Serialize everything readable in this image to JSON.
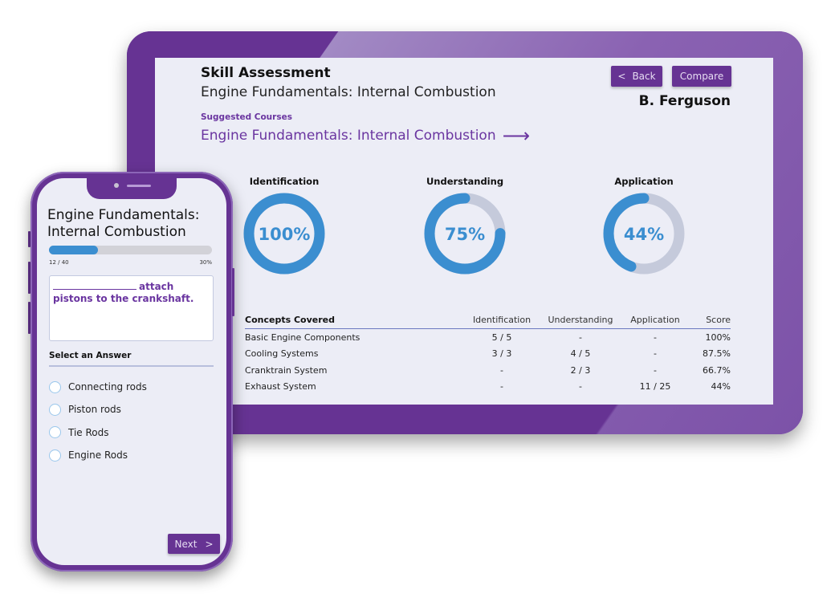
{
  "tablet": {
    "title": "Skill Assessment",
    "subtitle": "Engine Fundamentals: Internal Combustion",
    "suggested_label": "Suggested Courses",
    "suggested_course": "Engine Fundamentals: Internal Combustion",
    "suggested_arrow": "⟶",
    "back_button": {
      "icon": "<",
      "label": "Back"
    },
    "compare_button": "Compare",
    "user_name": "B. Ferguson",
    "gauges": [
      {
        "label": "Identification",
        "value_text": "100%",
        "percent": 100
      },
      {
        "label": "Understanding",
        "value_text": "75%",
        "percent": 75
      },
      {
        "label": "Application",
        "value_text": "44%",
        "percent": 44
      }
    ],
    "gauge_colors": {
      "fill": "#3b8ed0",
      "track": "#c5cadb"
    },
    "table": {
      "headers": [
        "Concepts Covered",
        "Identification",
        "Understanding",
        "Application",
        "Score"
      ],
      "rows": [
        [
          "Basic Engine Components",
          "5 / 5",
          "-",
          "-",
          "100%"
        ],
        [
          "Cooling Systems",
          "3 / 3",
          "4 / 5",
          "-",
          "87.5%"
        ],
        [
          "Cranktrain System",
          "-",
          "2 / 3",
          "-",
          "66.7%"
        ],
        [
          "Exhaust System",
          "-",
          "-",
          "11 / 25",
          "44%"
        ]
      ]
    }
  },
  "phone": {
    "title": "Engine Fundamentals: Internal Combustion",
    "progress": {
      "count_text": "12 / 40",
      "percent_text": "30%",
      "percent": 30
    },
    "question": "attach pistons to the crankshaft.",
    "select_label": "Select an Answer",
    "options": [
      "Connecting rods",
      "Piston rods",
      "Tie Rods",
      "Engine Rods"
    ],
    "next_button": {
      "label": "Next",
      "icon": ">"
    }
  },
  "colors": {
    "brand": "#663393",
    "accent": "#3b8ed0",
    "screen_bg": "#ecedf6"
  }
}
